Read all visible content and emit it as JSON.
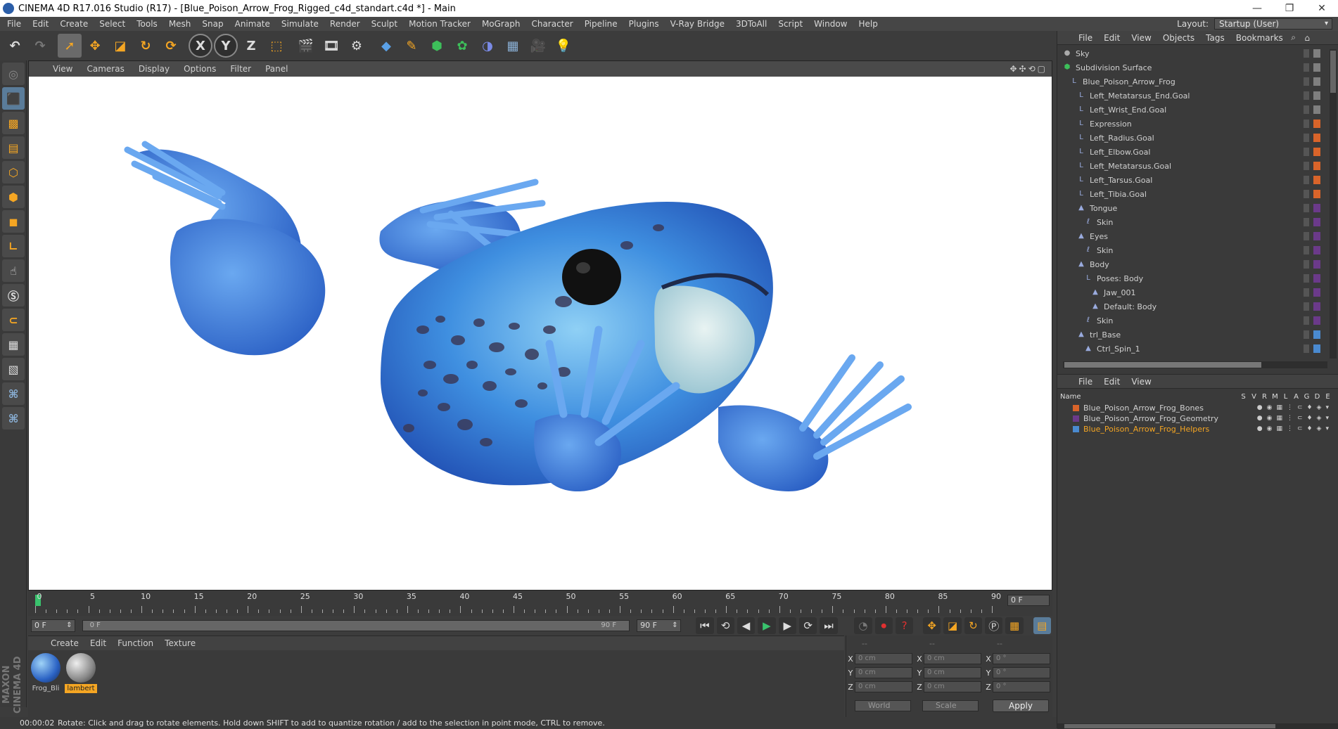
{
  "window": {
    "title": "CINEMA 4D R17.016 Studio (R17) - [Blue_Poison_Arrow_Frog_Rigged_c4d_standart.c4d *] - Main"
  },
  "menubar": [
    "File",
    "Edit",
    "Create",
    "Select",
    "Tools",
    "Mesh",
    "Snap",
    "Animate",
    "Simulate",
    "Render",
    "Sculpt",
    "Motion Tracker",
    "MoGraph",
    "Character",
    "Pipeline",
    "Plugins",
    "V-Ray Bridge",
    "3DToAll",
    "Script",
    "Window",
    "Help"
  ],
  "layout": {
    "label": "Layout:",
    "value": "Startup (User)"
  },
  "toolbar": {
    "x_label": "X",
    "y_label": "Y",
    "z_label": "Z"
  },
  "viewport": {
    "menu": [
      "View",
      "Cameras",
      "Display",
      "Options",
      "Filter",
      "Panel"
    ]
  },
  "timeline": {
    "ticks": [
      "0",
      "5",
      "10",
      "15",
      "20",
      "25",
      "30",
      "35",
      "40",
      "45",
      "50",
      "55",
      "60",
      "65",
      "70",
      "75",
      "80",
      "85",
      "90"
    ],
    "current_frame": "0 F",
    "start_field": "0 F",
    "slider_start": "0 F",
    "slider_end": "90 F",
    "end_field": "90 F"
  },
  "material_manager": {
    "menu": [
      "Create",
      "Edit",
      "Function",
      "Texture"
    ],
    "materials": [
      {
        "label": "Frog_Bli",
        "selected": false
      },
      {
        "label": "lambert",
        "selected": true
      }
    ]
  },
  "coords": {
    "header": [
      "--",
      "--",
      "--"
    ],
    "pos_x": "0 cm",
    "pos_y": "0 cm",
    "pos_z": "0 cm",
    "size_x": "0 cm",
    "size_y": "0 cm",
    "size_z": "0 cm",
    "rot_x": "0 °",
    "rot_y": "0 °",
    "rot_z": "0 °",
    "axis_x": "X",
    "axis_y": "Y",
    "axis_z": "Z",
    "world": "World",
    "scale": "Scale",
    "apply": "Apply"
  },
  "status": {
    "time": "00:00:02",
    "message": "Rotate: Click and drag to rotate elements. Hold down SHIFT to add to quantize rotation / add to the selection in point mode, CTRL to remove."
  },
  "branding": "MAXON CINEMA 4D",
  "object_manager": {
    "menu": [
      "File",
      "Edit",
      "View",
      "Objects",
      "Tags",
      "Bookmarks"
    ],
    "items": [
      {
        "label": "Sky",
        "indent": 0,
        "icon": "sky-icon",
        "color": "#7f7f7f"
      },
      {
        "label": "Subdivision Surface",
        "indent": 0,
        "icon": "subdivision-icon",
        "color": "#7f7f7f"
      },
      {
        "label": "Blue_Poison_Arrow_Frog",
        "indent": 1,
        "icon": "null-icon",
        "color": "#7f7f7f"
      },
      {
        "label": "Left_Metatarsus_End.Goal",
        "indent": 2,
        "icon": "null-icon",
        "color": "#7f7f7f"
      },
      {
        "label": "Left_Wrist_End.Goal",
        "indent": 2,
        "icon": "null-icon",
        "color": "#7f7f7f"
      },
      {
        "label": "Expression",
        "indent": 2,
        "icon": "null-icon",
        "color": "#d9642a"
      },
      {
        "label": "Left_Radius.Goal",
        "indent": 2,
        "icon": "null-icon",
        "color": "#d9642a"
      },
      {
        "label": "Left_Elbow.Goal",
        "indent": 2,
        "icon": "null-icon",
        "color": "#d9642a"
      },
      {
        "label": "Left_Metatarsus.Goal",
        "indent": 2,
        "icon": "null-icon",
        "color": "#d9642a"
      },
      {
        "label": "Left_Tarsus.Goal",
        "indent": 2,
        "icon": "null-icon",
        "color": "#d9642a"
      },
      {
        "label": "Left_Tibia.Goal",
        "indent": 2,
        "icon": "null-icon",
        "color": "#d9642a"
      },
      {
        "label": "Tongue",
        "indent": 2,
        "icon": "poly-icon",
        "color": "#6b3a8a"
      },
      {
        "label": "Skin",
        "indent": 3,
        "icon": "skin-icon",
        "color": "#6b3a8a"
      },
      {
        "label": "Eyes",
        "indent": 2,
        "icon": "poly-icon",
        "color": "#6b3a8a"
      },
      {
        "label": "Skin",
        "indent": 3,
        "icon": "skin-icon",
        "color": "#6b3a8a"
      },
      {
        "label": "Body",
        "indent": 2,
        "icon": "poly-icon",
        "color": "#6b3a8a"
      },
      {
        "label": "Poses: Body",
        "indent": 3,
        "icon": "null-icon",
        "color": "#6b3a8a"
      },
      {
        "label": "Jaw_001",
        "indent": 4,
        "icon": "poly-icon",
        "color": "#6b3a8a"
      },
      {
        "label": "Default: Body",
        "indent": 4,
        "icon": "poly-icon",
        "color": "#6b3a8a"
      },
      {
        "label": "Skin",
        "indent": 3,
        "icon": "skin-icon",
        "color": "#6b3a8a"
      },
      {
        "label": "trl_Base",
        "indent": 2,
        "icon": "poly-icon",
        "color": "#4a8ad0"
      },
      {
        "label": "Ctrl_Spin_1",
        "indent": 3,
        "icon": "poly-icon",
        "color": "#4a8ad0"
      }
    ]
  },
  "layer_manager": {
    "menu": [
      "File",
      "Edit",
      "View"
    ],
    "columns": {
      "name": "Name",
      "flags": [
        "S",
        "V",
        "R",
        "M",
        "L",
        "A",
        "G",
        "D",
        "E"
      ]
    },
    "layers": [
      {
        "label": "Blue_Poison_Arrow_Frog_Bones",
        "color": "#d9642a",
        "selected": false
      },
      {
        "label": "Blue_Poison_Arrow_Frog_Geometry",
        "color": "#6b3a8a",
        "selected": false
      },
      {
        "label": "Blue_Poison_Arrow_Frog_Helpers",
        "color": "#4a8ad0",
        "selected": true
      }
    ]
  },
  "colors": {
    "accent": "#f5a623",
    "frog_blue": "#3a7ad9",
    "play_green": "#39c36d"
  }
}
